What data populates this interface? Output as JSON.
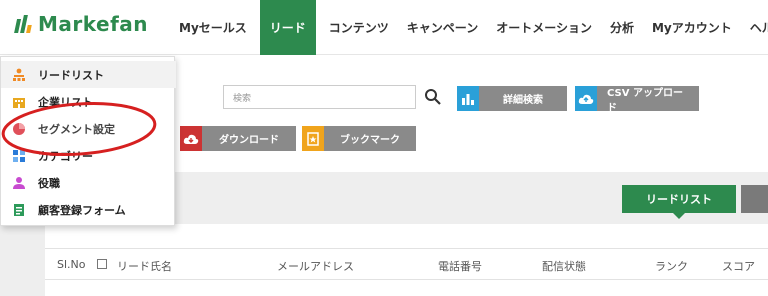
{
  "brand": {
    "logo_text": "Markefan"
  },
  "nav": {
    "items": [
      "Myセールス",
      "リード",
      "コンテンツ",
      "キャンペーン",
      "オートメーション",
      "分析",
      "Myアカウント",
      "ヘルプ"
    ],
    "active": "リード"
  },
  "dropdown": {
    "items": [
      {
        "label": "リードリスト",
        "icon": "org-chart-icon"
      },
      {
        "label": "企業リスト",
        "icon": "building-icon"
      },
      {
        "label": "セグメント設定",
        "icon": "pie-chart-icon"
      },
      {
        "label": "カテゴリー",
        "icon": "category-icon"
      },
      {
        "label": "役職",
        "icon": "person-icon"
      },
      {
        "label": "顧客登録フォーム",
        "icon": "form-icon"
      }
    ],
    "highlighted": "セグメント設定"
  },
  "search": {
    "label": "検索",
    "placeholder": ""
  },
  "toolbar": {
    "detail_search": "詳細検索",
    "csv_upload": "CSV アップロード",
    "download": "ダウンロード",
    "bookmark": "ブックマーク"
  },
  "tabs": {
    "lead_list": "リードリスト"
  },
  "table": {
    "headers": [
      "Sl.No",
      "リード氏名",
      "メールアドレス",
      "電話番号",
      "配信状態",
      "ランク",
      "スコア"
    ]
  },
  "colors": {
    "brand_green": "#2d8a4e",
    "accent_blue": "#2aa0d8",
    "annotation_red": "#d62020"
  }
}
